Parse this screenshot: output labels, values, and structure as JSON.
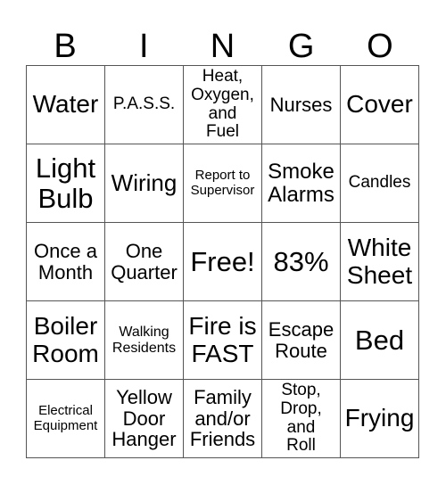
{
  "header": {
    "letters": [
      "B",
      "I",
      "N",
      "G",
      "O"
    ]
  },
  "cells": [
    [
      "Water",
      "P.A.S.S.",
      "Heat, Oxygen, and Fuel",
      "Nurses",
      "Cover"
    ],
    [
      "Light Bulb",
      "Wiring",
      "Report to Supervisor",
      "Smoke Alarms",
      "Candles"
    ],
    [
      "Once a Month",
      "One Quarter",
      "Free!",
      "83%",
      "White Sheet"
    ],
    [
      "Boiler Room",
      "Walking Residents",
      "Fire is FAST",
      "Escape Route",
      "Bed"
    ],
    [
      "Electrical Equipment",
      "Yellow Door Hanger",
      "Family and/or Friends",
      "Stop, Drop, and Roll",
      "Frying"
    ]
  ],
  "colors": {
    "grid_line": "#555555",
    "text": "#000000",
    "background": "#ffffff"
  }
}
